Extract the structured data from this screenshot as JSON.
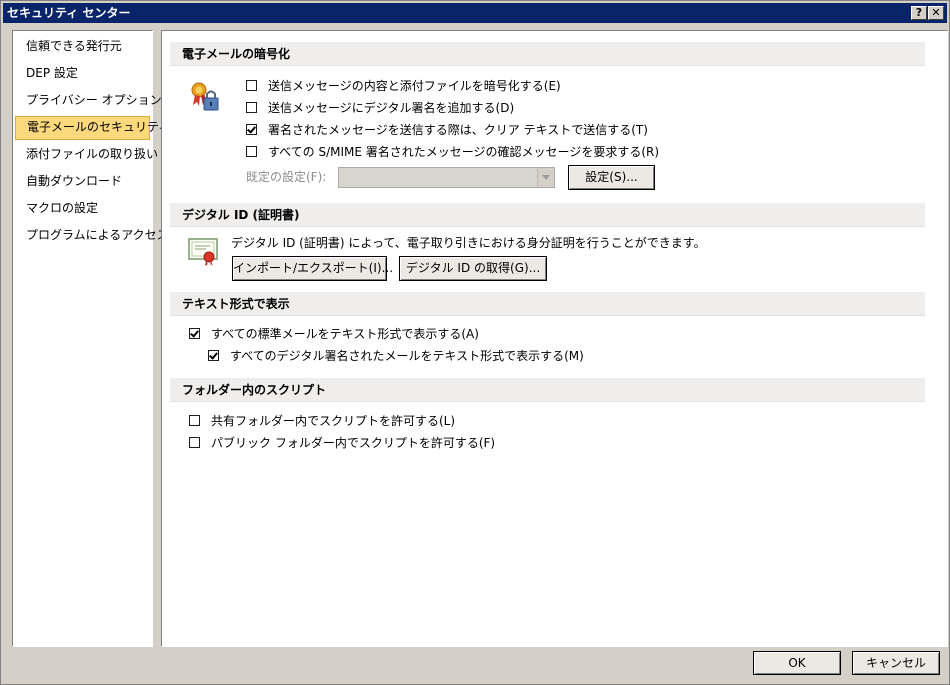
{
  "window": {
    "title": "セキュリティ センター",
    "help_label": "?",
    "close_label": "✕"
  },
  "sidebar": {
    "items": [
      {
        "label": "信頼できる発行元"
      },
      {
        "label": "DEP 設定"
      },
      {
        "label": "プライバシー オプション"
      },
      {
        "label": "電子メールのセキュリティ",
        "selected": true
      },
      {
        "label": "添付ファイルの取り扱い"
      },
      {
        "label": "自動ダウンロード"
      },
      {
        "label": "マクロの設定"
      },
      {
        "label": "プログラムによるアクセス"
      }
    ]
  },
  "encryption": {
    "header": "電子メールの暗号化",
    "options": [
      {
        "label": "送信メッセージの内容と添付ファイルを暗号化する(E)",
        "checked": false
      },
      {
        "label": "送信メッセージにデジタル署名を追加する(D)",
        "checked": false
      },
      {
        "label": "署名されたメッセージを送信する際は、クリア テキストで送信する(T)",
        "checked": true
      },
      {
        "label": "すべての S/MIME 署名されたメッセージの確認メッセージを要求する(R)",
        "checked": false
      }
    ],
    "default_setting_label": "既定の設定(F):",
    "default_setting_value": "",
    "settings_button": "設定(S)..."
  },
  "digital_id": {
    "header": "デジタル ID (証明書)",
    "description": "デジタル ID (証明書) によって、電子取り引きにおける身分証明を行うことができます。",
    "import_export_button": "インポート/エクスポート(I)...",
    "get_id_button": "デジタル ID の取得(G)..."
  },
  "plain_text": {
    "header": "テキスト形式で表示",
    "options": [
      {
        "label": "すべての標準メールをテキスト形式で表示する(A)",
        "checked": true
      },
      {
        "label": "すべてのデジタル署名されたメールをテキスト形式で表示する(M)",
        "checked": true
      }
    ]
  },
  "folder_scripts": {
    "header": "フォルダー内のスクリプト",
    "options": [
      {
        "label": "共有フォルダー内でスクリプトを許可する(L)",
        "checked": false
      },
      {
        "label": "パブリック フォルダー内でスクリプトを許可する(F)",
        "checked": false
      }
    ]
  },
  "footer": {
    "ok_label": "OK",
    "cancel_label": "キャンセル"
  }
}
